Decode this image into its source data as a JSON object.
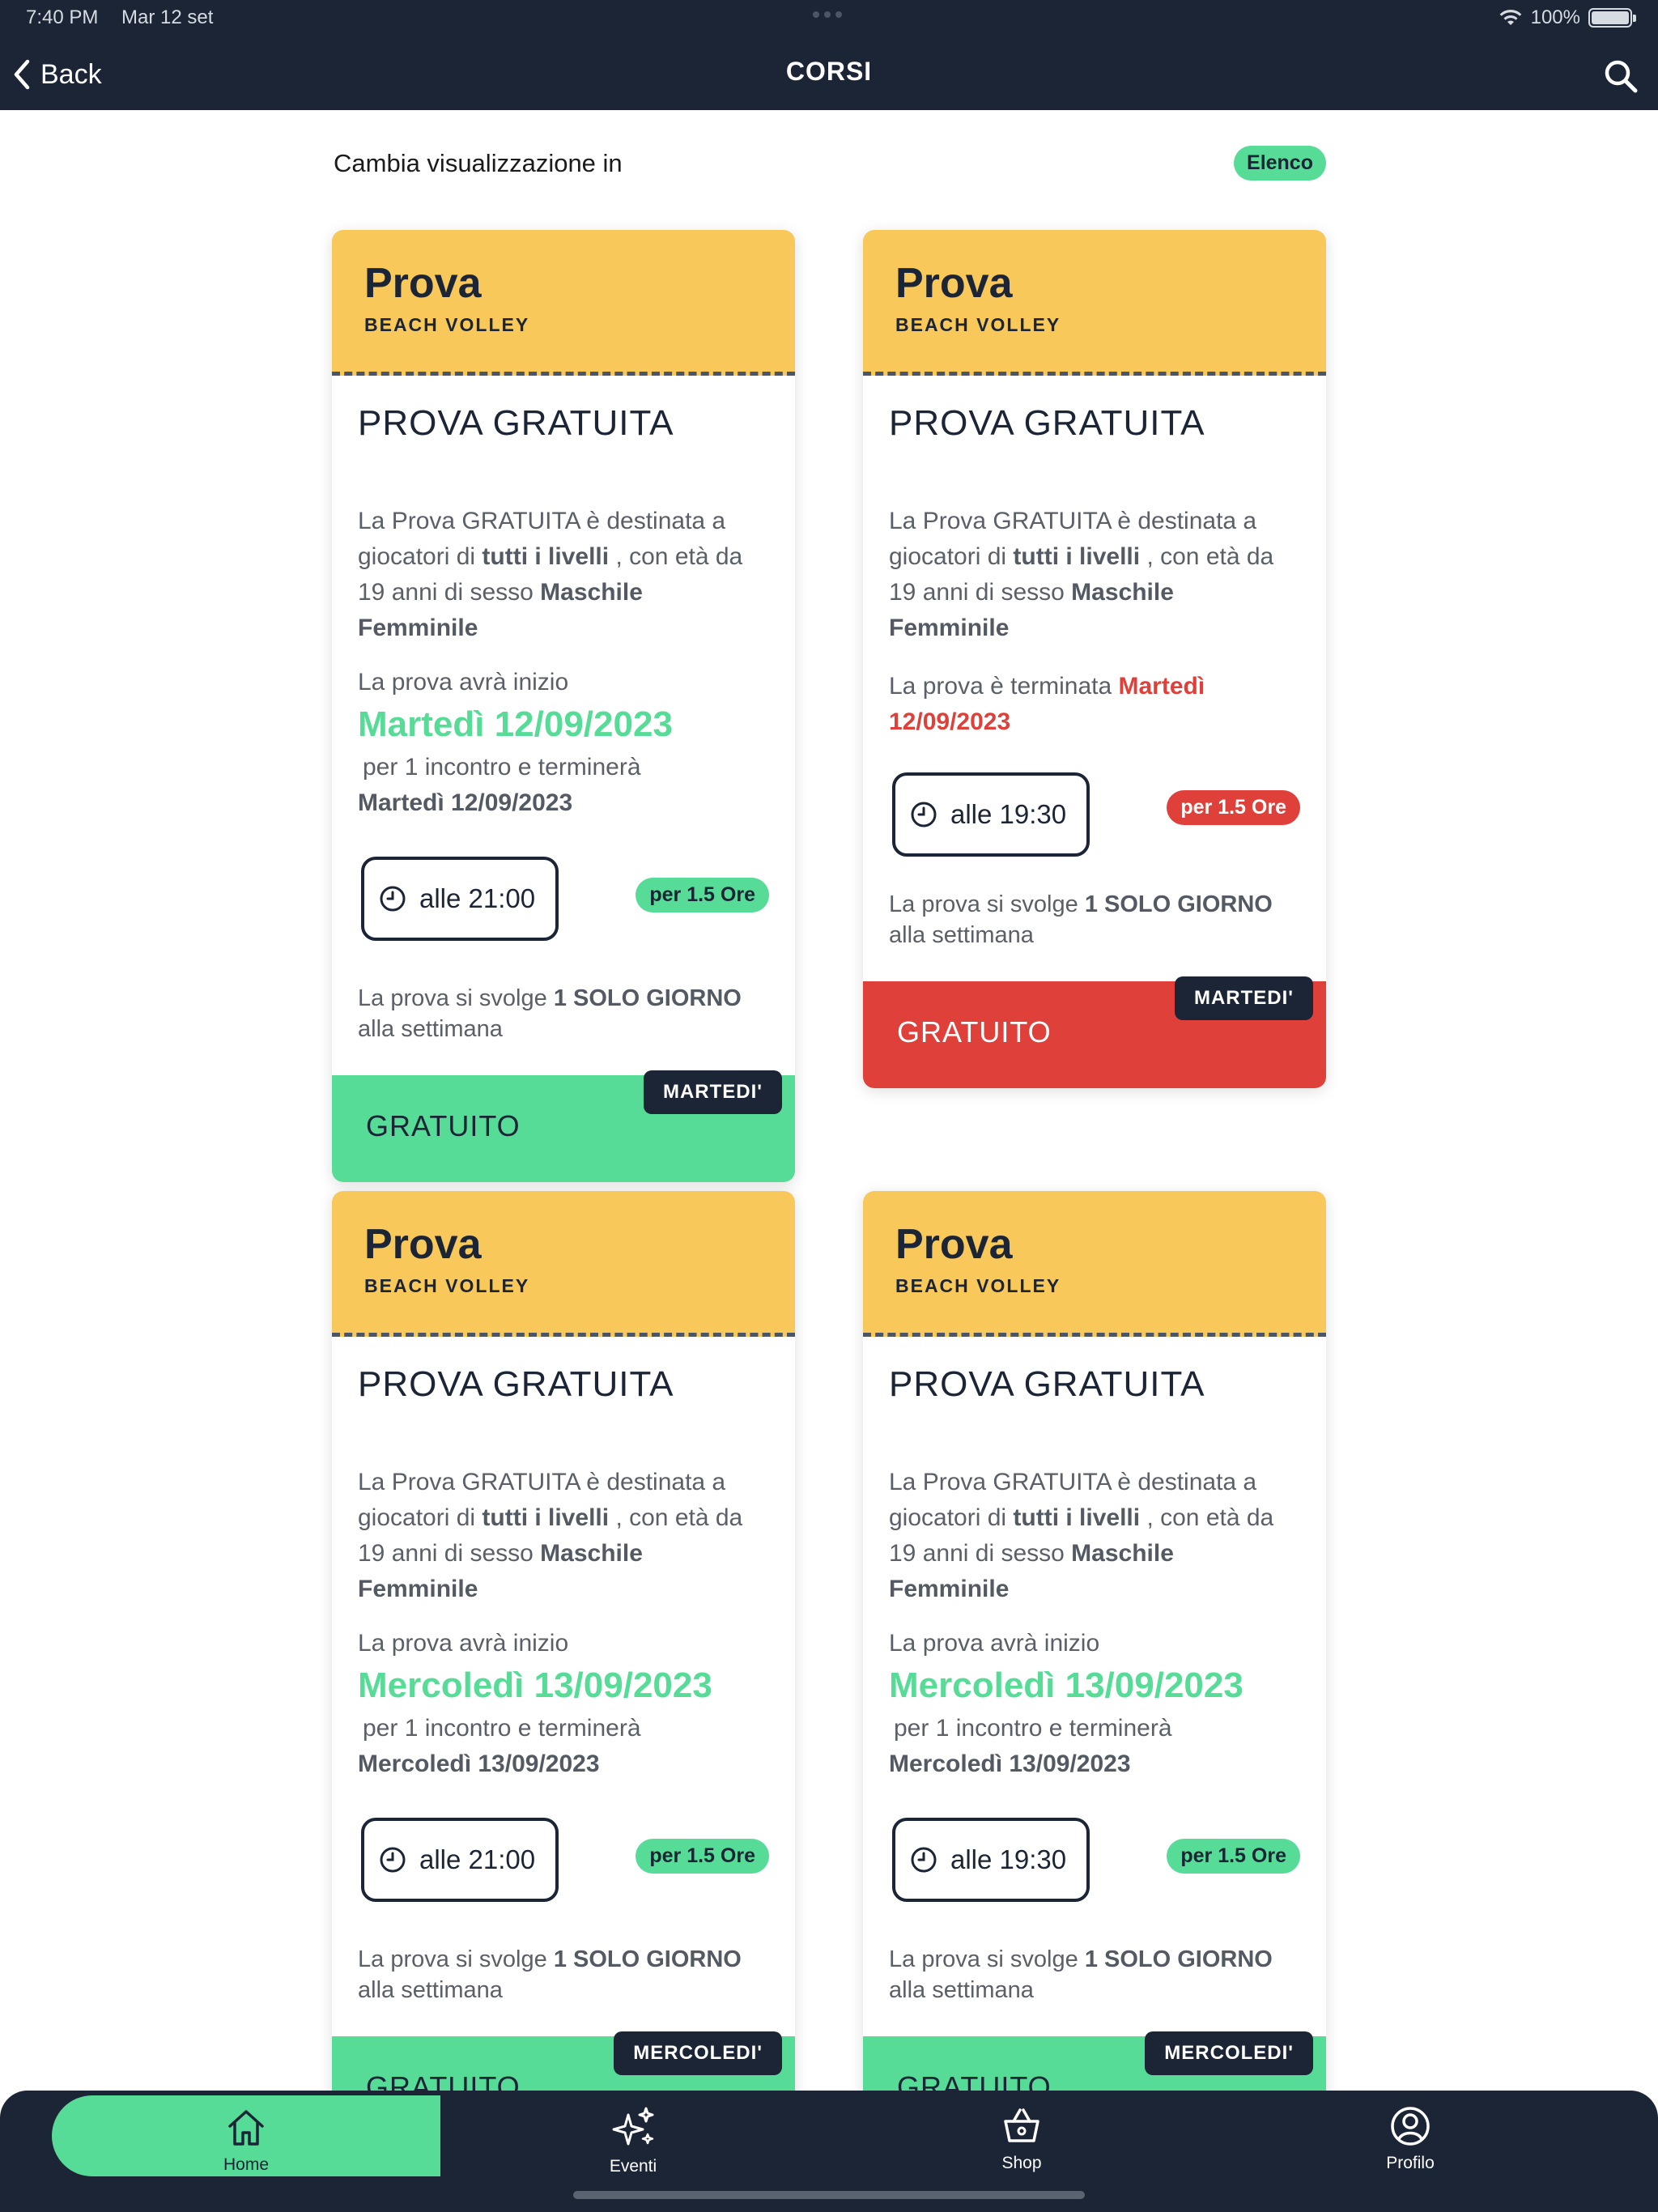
{
  "status": {
    "time": "7:40 PM",
    "date": "Mar 12 set",
    "battery": "100%"
  },
  "nav": {
    "back": "Back",
    "title": "CORSI"
  },
  "view_switch": {
    "label": "Cambia visualizzazione in",
    "badge": "Elenco"
  },
  "colors": {
    "navy": "#1b2536",
    "yellow": "#f8c85a",
    "green": "#56dc96",
    "red": "#e0403a"
  },
  "cards": [
    {
      "type": "Prova",
      "sport": "BEACH VOLLEY",
      "title": "PROVA GRATUITA",
      "desc_pre": "La Prova GRATUITA è destinata a giocatori di ",
      "level": "tutti i livelli",
      "desc_mid": " , con età da 19 anni di sesso ",
      "gender": "Maschile Femminile",
      "start_label": "La prova avrà inizio",
      "start_date": "Martedì 12/09/2023",
      "after_date": "per 1 incontro e terminerà",
      "end_date": "Martedì 12/09/2023",
      "time": "alle 21:00",
      "duration": "per 1.5 Ore",
      "freq_pre": "La prova si svolge ",
      "freq_bold": "1 SOLO GIORNO",
      "freq_post": "alla settimana",
      "price": "GRATUITO",
      "day": "MARTEDI'"
    },
    {
      "type": "Prova",
      "sport": "BEACH VOLLEY",
      "title": "PROVA GRATUITA",
      "desc_pre": "La Prova GRATUITA è destinata a giocatori di ",
      "level": "tutti i livelli",
      "desc_mid": " , con età da 19 anni di sesso ",
      "gender": "Maschile Femminile",
      "ended_label": "La prova è terminata ",
      "ended_date": "Martedì 12/09/2023",
      "time": "alle 19:30",
      "duration": "per 1.5 Ore",
      "freq_pre": "La prova si svolge ",
      "freq_bold": "1 SOLO GIORNO",
      "freq_post": "alla settimana",
      "price": "GRATUITO",
      "day": "MARTEDI'"
    },
    {
      "type": "Prova",
      "sport": "BEACH VOLLEY",
      "title": "PROVA GRATUITA",
      "desc_pre": "La Prova GRATUITA è destinata a giocatori di ",
      "level": "tutti i livelli",
      "desc_mid": " , con età da 19 anni di sesso ",
      "gender": "Maschile Femminile",
      "start_label": "La prova avrà inizio",
      "start_date": "Mercoledì 13/09/2023",
      "after_date": "per 1 incontro e terminerà",
      "end_date": "Mercoledì 13/09/2023",
      "time": "alle 21:00",
      "duration": "per 1.5 Ore",
      "freq_pre": "La prova si svolge ",
      "freq_bold": "1 SOLO GIORNO",
      "freq_post": "alla settimana",
      "price": "GRATUITO",
      "day": "MERCOLEDI'"
    },
    {
      "type": "Prova",
      "sport": "BEACH VOLLEY",
      "title": "PROVA GRATUITA",
      "desc_pre": "La Prova GRATUITA è destinata a giocatori di ",
      "level": "tutti i livelli",
      "desc_mid": " , con età da 19 anni di sesso ",
      "gender": "Maschile Femminile",
      "start_label": "La prova avrà inizio",
      "start_date": "Mercoledì 13/09/2023",
      "after_date": "per 1 incontro e terminerà",
      "end_date": "Mercoledì 13/09/2023",
      "time": "alle 19:30",
      "duration": "per 1.5 Ore",
      "freq_pre": "La prova si svolge ",
      "freq_bold": "1 SOLO GIORNO",
      "freq_post": "alla settimana",
      "price": "GRATUITO",
      "day": "MERCOLEDI'"
    }
  ],
  "tabs": [
    {
      "label": "Home",
      "icon": "home-icon",
      "active": true
    },
    {
      "label": "Eventi",
      "icon": "sparkles-icon",
      "active": false
    },
    {
      "label": "Shop",
      "icon": "basket-icon",
      "active": false
    },
    {
      "label": "Profilo",
      "icon": "user-circle-icon",
      "active": false
    }
  ]
}
